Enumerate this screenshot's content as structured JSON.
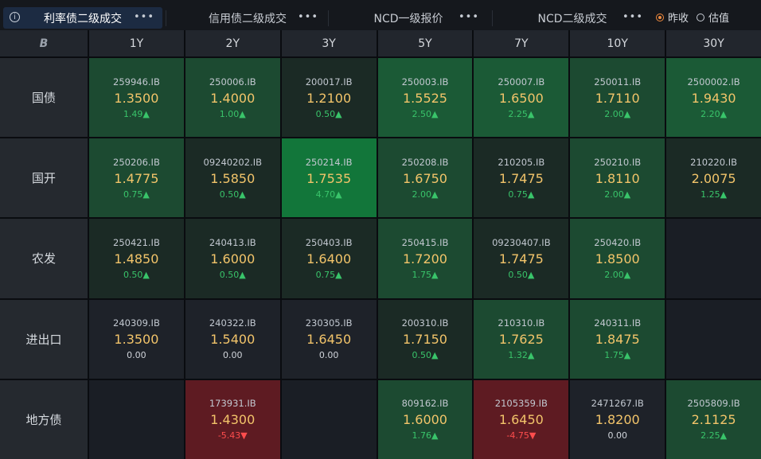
{
  "tabs": [
    {
      "label": "利率债二级成交",
      "active": true
    },
    {
      "label": "信用债二级成交",
      "active": false
    },
    {
      "label": "NCD一级报价",
      "active": false
    },
    {
      "label": "NCD二级成交",
      "active": false
    }
  ],
  "tab_menu_glyph": "•••",
  "info_glyph": "i",
  "radio_options": [
    {
      "label": "昨收",
      "checked": true
    },
    {
      "label": "估值",
      "checked": false
    }
  ],
  "corner_logo": "B",
  "columns": [
    "1Y",
    "2Y",
    "3Y",
    "5Y",
    "7Y",
    "10Y",
    "30Y"
  ],
  "rows": [
    {
      "label": "国债",
      "cells": [
        {
          "code": "259946.IB",
          "yield": "1.3500",
          "change": "1.49▲",
          "dir": "up",
          "shade": "mid"
        },
        {
          "code": "250006.IB",
          "yield": "1.4000",
          "change": "1.00▲",
          "dir": "up",
          "shade": "mid"
        },
        {
          "code": "200017.IB",
          "yield": "1.2100",
          "change": "0.50▲",
          "dir": "up",
          "shade": "dark"
        },
        {
          "code": "250003.IB",
          "yield": "1.5525",
          "change": "2.50▲",
          "dir": "up",
          "shade": "light"
        },
        {
          "code": "250007.IB",
          "yield": "1.6500",
          "change": "2.25▲",
          "dir": "up",
          "shade": "light"
        },
        {
          "code": "250011.IB",
          "yield": "1.7110",
          "change": "2.00▲",
          "dir": "up",
          "shade": "mid"
        },
        {
          "code": "2500002.IB",
          "yield": "1.9430",
          "change": "2.20▲",
          "dir": "up",
          "shade": "light"
        }
      ]
    },
    {
      "label": "国开",
      "cells": [
        {
          "code": "250206.IB",
          "yield": "1.4775",
          "change": "0.75▲",
          "dir": "up",
          "shade": "mid"
        },
        {
          "code": "09240202.IB",
          "yield": "1.5850",
          "change": "0.50▲",
          "dir": "up",
          "shade": "dark"
        },
        {
          "code": "250214.IB",
          "yield": "1.7535",
          "change": "4.70▲",
          "dir": "up",
          "shade": "bright"
        },
        {
          "code": "250208.IB",
          "yield": "1.6750",
          "change": "2.00▲",
          "dir": "up",
          "shade": "mid"
        },
        {
          "code": "210205.IB",
          "yield": "1.7475",
          "change": "0.75▲",
          "dir": "up",
          "shade": "dark"
        },
        {
          "code": "250210.IB",
          "yield": "1.8110",
          "change": "2.00▲",
          "dir": "up",
          "shade": "mid"
        },
        {
          "code": "210220.IB",
          "yield": "2.0075",
          "change": "1.25▲",
          "dir": "up",
          "shade": "dark"
        }
      ]
    },
    {
      "label": "农发",
      "cells": [
        {
          "code": "250421.IB",
          "yield": "1.4850",
          "change": "0.50▲",
          "dir": "up",
          "shade": "dark"
        },
        {
          "code": "240413.IB",
          "yield": "1.6000",
          "change": "0.50▲",
          "dir": "up",
          "shade": "dark"
        },
        {
          "code": "250403.IB",
          "yield": "1.6400",
          "change": "0.75▲",
          "dir": "up",
          "shade": "dark"
        },
        {
          "code": "250415.IB",
          "yield": "1.7200",
          "change": "1.75▲",
          "dir": "up",
          "shade": "mid"
        },
        {
          "code": "09230407.IB",
          "yield": "1.7475",
          "change": "0.50▲",
          "dir": "up",
          "shade": "dark"
        },
        {
          "code": "250420.IB",
          "yield": "1.8500",
          "change": "2.00▲",
          "dir": "up",
          "shade": "mid"
        },
        null
      ]
    },
    {
      "label": "进出口",
      "cells": [
        {
          "code": "240309.IB",
          "yield": "1.3500",
          "change": "0.00",
          "dir": "flat",
          "shade": "neutral"
        },
        {
          "code": "240322.IB",
          "yield": "1.5400",
          "change": "0.00",
          "dir": "flat",
          "shade": "neutral"
        },
        {
          "code": "230305.IB",
          "yield": "1.6450",
          "change": "0.00",
          "dir": "flat",
          "shade": "neutral"
        },
        {
          "code": "200310.IB",
          "yield": "1.7150",
          "change": "0.50▲",
          "dir": "up",
          "shade": "dark"
        },
        {
          "code": "210310.IB",
          "yield": "1.7625",
          "change": "1.32▲",
          "dir": "up",
          "shade": "mid"
        },
        {
          "code": "240311.IB",
          "yield": "1.8475",
          "change": "1.75▲",
          "dir": "up",
          "shade": "mid"
        },
        null
      ]
    },
    {
      "label": "地方债",
      "cells": [
        null,
        {
          "code": "173931.IB",
          "yield": "1.4300",
          "change": "-5.43▼",
          "dir": "down",
          "shade": "red"
        },
        null,
        {
          "code": "809162.IB",
          "yield": "1.6000",
          "change": "1.76▲",
          "dir": "up",
          "shade": "mid"
        },
        {
          "code": "2105359.IB",
          "yield": "1.6450",
          "change": "-4.75▼",
          "dir": "down",
          "shade": "red"
        },
        {
          "code": "2471267.IB",
          "yield": "1.8200",
          "change": "0.00",
          "dir": "flat",
          "shade": "neutral"
        },
        {
          "code": "2505809.IB",
          "yield": "2.1125",
          "change": "2.25▲",
          "dir": "up",
          "shade": "mid"
        }
      ]
    }
  ]
}
